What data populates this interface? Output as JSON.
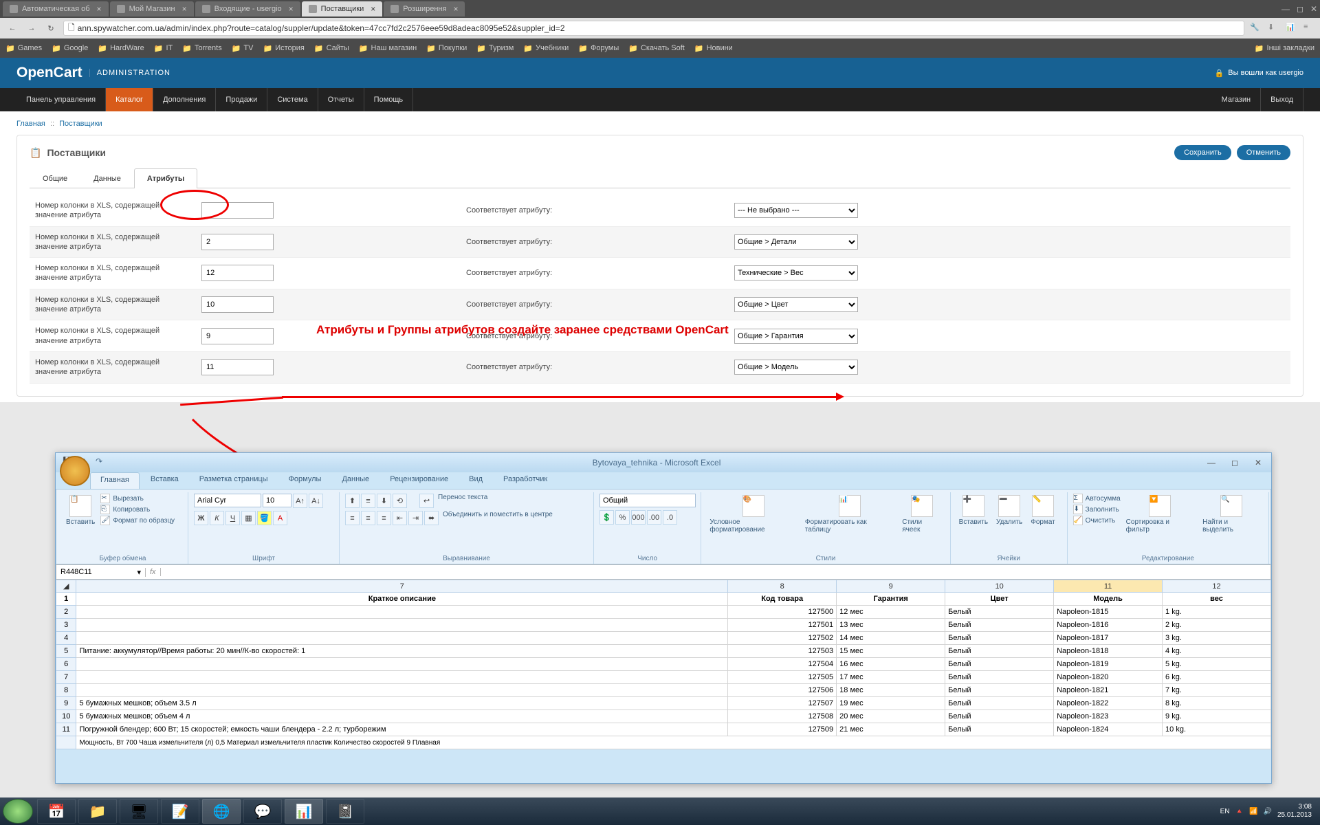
{
  "chrome": {
    "tabs": [
      {
        "title": "Автоматическая об",
        "active": false
      },
      {
        "title": "Мой Магазин",
        "active": false
      },
      {
        "title": "Входящие - usergio",
        "active": false
      },
      {
        "title": "Поставщики",
        "active": true
      },
      {
        "title": "Розширення",
        "active": false
      }
    ],
    "url": "ann.spywatcher.com.ua/admin/index.php?route=catalog/suppler/update&token=47cc7fd2c2576eee59d8adeac8095e52&suppler_id=2",
    "bookmarks": [
      "Games",
      "Google",
      "HardWare",
      "IT",
      "Torrents",
      "TV",
      "История",
      "Сайты",
      "Наш магазин",
      "Покупки",
      "Туризм",
      "Учебники",
      "Форумы",
      "Скачать Soft",
      "Новини"
    ],
    "bookmarks_more": "Інші закладки"
  },
  "opencart": {
    "logo": "OpenCart",
    "logo_sub": "ADMINISTRATION",
    "login_msg": "Вы вошли как usergio",
    "menu": [
      "Панель управления",
      "Каталог",
      "Дополнения",
      "Продажи",
      "Система",
      "Отчеты",
      "Помощь"
    ],
    "menu_active": 1,
    "menu_right": [
      "Магазин",
      "Выход"
    ],
    "breadcrumb": [
      "Главная",
      "Поставщики"
    ],
    "panel_title": "Поставщики",
    "btn_save": "Сохранить",
    "btn_cancel": "Отменить",
    "tabs": [
      "Общие",
      "Данные",
      "Атрибуты"
    ],
    "tab_active": 2,
    "row_label": "Номер колонки в XLS, содержащей значение атрибута",
    "row_label2": "Соответствует атрибуту:",
    "rows": [
      {
        "col": "",
        "attr": "--- Не выбрано ---"
      },
      {
        "col": "2",
        "attr": "Общие > Детали"
      },
      {
        "col": "12",
        "attr": "Технические > Вес"
      },
      {
        "col": "10",
        "attr": "Общие > Цвет"
      },
      {
        "col": "9",
        "attr": "Общие > Гарантия"
      },
      {
        "col": "11",
        "attr": "Общие > Модель"
      }
    ],
    "note": "Атрибуты и Группы атрибутов создайте заранее средствами OpenCart"
  },
  "excel": {
    "title": "Bytovaya_tehnika - Microsoft Excel",
    "rtabs": [
      "Главная",
      "Вставка",
      "Разметка страницы",
      "Формулы",
      "Данные",
      "Рецензирование",
      "Вид",
      "Разработчик"
    ],
    "rtab_active": 0,
    "clipboard": {
      "paste": "Вставить",
      "cut": "Вырезать",
      "copy": "Копировать",
      "brush": "Формат по образцу",
      "grp": "Буфер обмена"
    },
    "font": {
      "name": "Arial Cyr",
      "size": "10",
      "grp": "Шрифт"
    },
    "align": {
      "wrap": "Перенос текста",
      "merge": "Объединить и поместить в центре",
      "grp": "Выравнивание"
    },
    "number": {
      "fmt": "Общий",
      "grp": "Число"
    },
    "styles": {
      "cond": "Условное форматирование",
      "tbl": "Форматировать как таблицу",
      "cell": "Стили ячеек",
      "grp": "Стили"
    },
    "cells": {
      "ins": "Вставить",
      "del": "Удалить",
      "fmt": "Формат",
      "grp": "Ячейки"
    },
    "editing": {
      "sum": "Автосумма",
      "fill": "Заполнить",
      "clear": "Очистить",
      "sort": "Сортировка и фильтр",
      "find": "Найти и выделить",
      "grp": "Редактирование"
    },
    "namebox": "R448C11",
    "cols": [
      "7",
      "8",
      "9",
      "10",
      "11",
      "12"
    ],
    "headers": [
      "Краткое описание",
      "Код товара",
      "Гарантия",
      "Цвет",
      "Модель",
      "вес"
    ],
    "selected_col_idx": 4,
    "data": [
      {
        "r": 2,
        "c7": "",
        "c8": "127500",
        "c9": "12 мес",
        "c10": "Белый",
        "c11": "Napoleon-1815",
        "c12": "1 kg."
      },
      {
        "r": 3,
        "c7": "",
        "c8": "127501",
        "c9": "13 мес",
        "c10": "Белый",
        "c11": "Napoleon-1816",
        "c12": "2 kg."
      },
      {
        "r": 4,
        "c7": "",
        "c8": "127502",
        "c9": "14 мес",
        "c10": "Белый",
        "c11": "Napoleon-1817",
        "c12": "3 kg."
      },
      {
        "r": 5,
        "c7": "Питание: аккумулятор//Время работы: 20 мин//К-во скоростей: 1",
        "c8": "127503",
        "c9": "15 мес",
        "c10": "Белый",
        "c11": "Napoleon-1818",
        "c12": "4 kg."
      },
      {
        "r": 6,
        "c7": "",
        "c8": "127504",
        "c9": "16 мес",
        "c10": "Белый",
        "c11": "Napoleon-1819",
        "c12": "5 kg."
      },
      {
        "r": 7,
        "c7": "",
        "c8": "127505",
        "c9": "17 мес",
        "c10": "Белый",
        "c11": "Napoleon-1820",
        "c12": "6 kg."
      },
      {
        "r": 8,
        "c7": "",
        "c8": "127506",
        "c9": "18 мес",
        "c10": "Белый",
        "c11": "Napoleon-1821",
        "c12": "7 kg."
      },
      {
        "r": 9,
        "c7": "5 бумажных мешков; объем 3.5 л",
        "c8": "127507",
        "c9": "19 мес",
        "c10": "Белый",
        "c11": "Napoleon-1822",
        "c12": "8 kg."
      },
      {
        "r": 10,
        "c7": "5 бумажных мешков; объем 4 л",
        "c8": "127508",
        "c9": "20 мес",
        "c10": "Белый",
        "c11": "Napoleon-1823",
        "c12": "9 kg."
      },
      {
        "r": 11,
        "c7": "Погружной блендер; 600 Вт; 15 скоростей; емкость чаши блендера - 2.2 л; турборежим",
        "c8": "127509",
        "c9": "21 мес",
        "c10": "Белый",
        "c11": "Napoleon-1824",
        "c12": "10 kg."
      }
    ],
    "truncated_row": "Мощность, Вт 700 &#xD;&#xA;Чаша измельчителя (л) 0,5 &#xD;&#xA;Материал измельчителя пластик Количество скоростей 9 Плавная"
  },
  "taskbar": {
    "lang": "EN",
    "time": "3:08",
    "date": "25.01.2013"
  }
}
